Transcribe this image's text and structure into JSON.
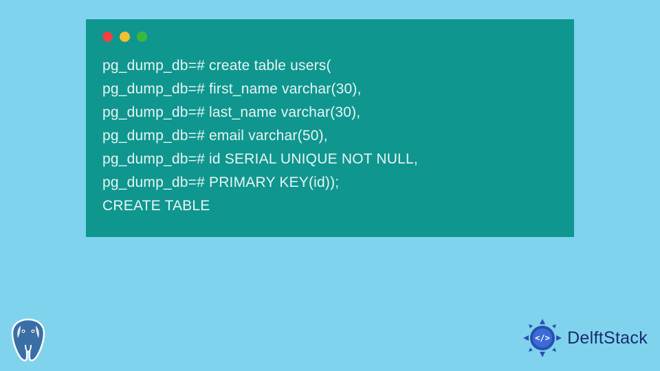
{
  "terminal": {
    "lines": [
      "pg_dump_db=# create table users(",
      "pg_dump_db=# first_name varchar(30),",
      "pg_dump_db=# last_name varchar(30),",
      "pg_dump_db=# email varchar(50),",
      "pg_dump_db=# id SERIAL UNIQUE NOT NULL,",
      "pg_dump_db=# PRIMARY KEY(id));",
      "CREATE TABLE"
    ]
  },
  "branding": {
    "delftstack_label": "DelftStack"
  },
  "colors": {
    "background": "#7fd3ed",
    "terminal_bg": "#0f968f",
    "terminal_fg": "#e8f5f4",
    "dot_red": "#ed4240",
    "dot_yellow": "#f2bf30",
    "dot_green": "#3bb93e",
    "brand_text": "#1a2a6c"
  }
}
